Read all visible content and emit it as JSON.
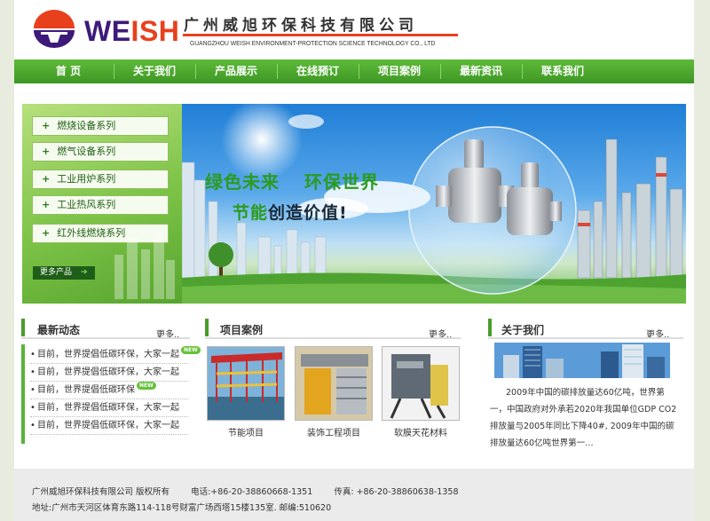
{
  "header": {
    "logo_text_1": "WE",
    "logo_text_2": "ISH",
    "company_cn": "广州威旭环保科技有限公司",
    "company_en": "GUANGZHOU WEISH ENVIRONMENT-PROTECTION SCIENCE TECHNOLOGY CO., LTD"
  },
  "nav": {
    "items": [
      "首  页",
      "关于我们",
      "产品展示",
      "在线预订",
      "项目案例",
      "最新资讯",
      "联系我们"
    ]
  },
  "side_menu": {
    "items": [
      "燃烧设备系列",
      "燃气设备系列",
      "工业用炉系列",
      "工业热风系列",
      "红外线燃烧系列"
    ],
    "more_label": "更多产品"
  },
  "banner": {
    "slogan_1a": "绿色未来",
    "slogan_1b": "环保世界",
    "slogan_2a": "节能",
    "slogan_2b": "创造价值!"
  },
  "news": {
    "title": "最新动态",
    "more": "更多",
    "items": [
      {
        "text": "目前，世界提倡低碳环保，大家一起",
        "badge": "NEW"
      },
      {
        "text": "目前，世界提倡低碳环保，大家一起",
        "badge": ""
      },
      {
        "text": "目前，世界提倡低碳环保",
        "badge": "NEW"
      },
      {
        "text": "目前，世界提倡低碳环保，大家一起",
        "badge": ""
      },
      {
        "text": "目前，世界提倡低碳环保，大家一起",
        "badge": ""
      }
    ]
  },
  "projects": {
    "title": "项目案例",
    "more": "更多",
    "items": [
      "节能项目",
      "装饰工程项目",
      "软膜天花材料"
    ]
  },
  "about": {
    "title": "关于我们",
    "more": "更多",
    "text": "2009年中国的碳排放量达60亿吨，世界第一，中国政府对外承若2020年我国单位GDP CO2排放量与2005年同比下降40#, 2009年中国的碳排放量达60亿吨世界第一…"
  },
  "footer": {
    "copyright": "广州威旭环保科技有限公司    版权所有",
    "phone": "电话:+86-20-38860668-1351",
    "fax": "传真: +86-20-38860638-1358",
    "address": "地址:广州市天河区体育东路114-118号财富广场西塔15楼135室. 邮编:510620"
  },
  "colors": {
    "brand_green": "#3d9724",
    "brand_purple": "#3d1a7a",
    "brand_red": "#e8401c"
  }
}
